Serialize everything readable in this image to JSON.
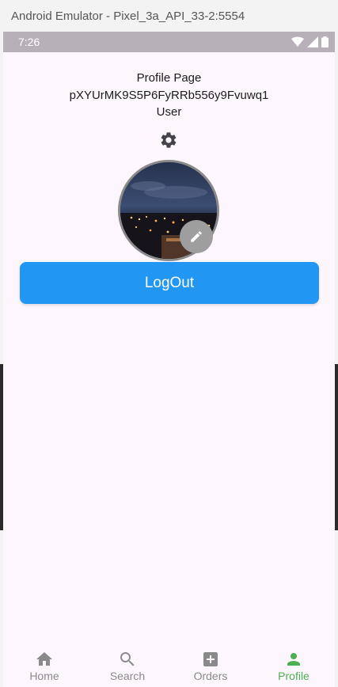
{
  "window": {
    "title": "Android Emulator - Pixel_3a_API_33-2:5554"
  },
  "status_bar": {
    "time": "7:26",
    "icons": [
      "wifi-icon",
      "signal-icon",
      "battery-icon"
    ]
  },
  "profile": {
    "page_title": "Profile Page",
    "user_id": "pXYUrMK9S5P6FyRRb556y9Fvuwq1",
    "role": "User",
    "settings_icon": "gear-icon",
    "edit_icon": "pencil-icon",
    "logout_label": "LogOut"
  },
  "bottom_nav": {
    "items": [
      {
        "label": "Home",
        "icon": "home-icon"
      },
      {
        "label": "Search",
        "icon": "search-icon"
      },
      {
        "label": "Orders",
        "icon": "add-box-icon"
      },
      {
        "label": "Profile",
        "icon": "person-icon"
      }
    ],
    "active_index": 3
  },
  "colors": {
    "background": "#fdf7fd",
    "status_bar": "#b8b0b9",
    "primary": "#2196f3",
    "active_nav": "#4caf50",
    "inactive_nav": "#8a8a8a"
  }
}
